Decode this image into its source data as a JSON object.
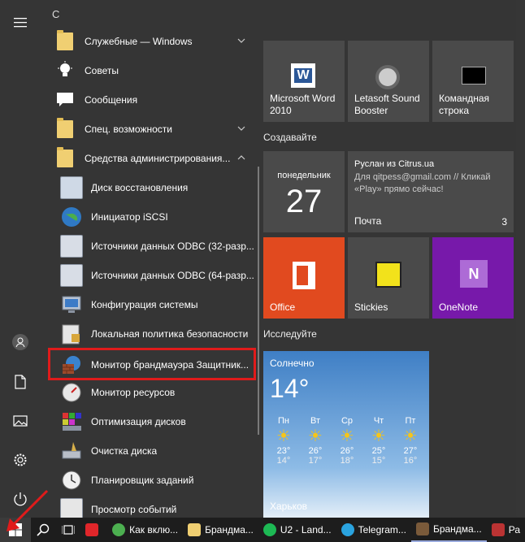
{
  "rail": {
    "icons": [
      "hamburger-icon",
      "user-icon",
      "document-icon",
      "pictures-icon",
      "settings-icon",
      "power-icon"
    ]
  },
  "applist": {
    "letter": "С",
    "items": [
      {
        "label": "Служебные — Windows",
        "icon": "folder-icon",
        "chevron": "down"
      },
      {
        "label": "Советы",
        "icon": "lightbulb-icon"
      },
      {
        "label": "Сообщения",
        "icon": "chat-icon"
      },
      {
        "label": "Спец. возможности",
        "icon": "folder-icon",
        "chevron": "down"
      },
      {
        "label": "Средства администрирования...",
        "icon": "folder-icon",
        "chevron": "up"
      },
      {
        "label": "Диск восстановления",
        "icon": "recovery-drive-icon"
      },
      {
        "label": "Инициатор iSCSI",
        "icon": "iscsi-globe-icon"
      },
      {
        "label": "Источники данных ODBC (32-разр...",
        "icon": "odbc-icon"
      },
      {
        "label": "Источники данных ODBC (64-разр...",
        "icon": "odbc-icon"
      },
      {
        "label": "Конфигурация системы",
        "icon": "system-config-icon"
      },
      {
        "label": "Локальная политика безопасности",
        "icon": "security-policy-icon"
      },
      {
        "label": "Монитор брандмауэра Защитник...",
        "icon": "firewall-icon"
      },
      {
        "label": "Монитор ресурсов",
        "icon": "resource-monitor-icon"
      },
      {
        "label": "Оптимизация дисков",
        "icon": "defrag-icon"
      },
      {
        "label": "Очистка диска",
        "icon": "disk-cleanup-icon"
      },
      {
        "label": "Планировщик заданий",
        "icon": "task-scheduler-icon"
      },
      {
        "label": "Просмотр событий",
        "icon": "event-viewer-icon"
      }
    ]
  },
  "tiles": {
    "top": [
      {
        "label": "Microsoft Word 2010",
        "icon": "word-icon"
      },
      {
        "label": "Letasoft Sound Booster",
        "icon": "speaker-icon"
      },
      {
        "label": "Командная строка",
        "icon": "cmd-icon"
      }
    ],
    "group1": "Создавайте",
    "calendar": {
      "day": "понедельник",
      "date": "27"
    },
    "mail": {
      "sender": "Руслан из Citrus.ua",
      "body": "Для qitpess@gmail.com // Кликай «Play» прямо сейчас!",
      "app": "Почта",
      "count": "3"
    },
    "row3": [
      {
        "label": "Office",
        "color": "#e14a1f"
      },
      {
        "label": "Stickies",
        "color": "#4a4a4a"
      },
      {
        "label": "OneNote",
        "color": "#7719aa"
      }
    ],
    "group2": "Исследуйте",
    "weather": {
      "condition": "Солнечно",
      "temp": "14°",
      "city": "Харьков",
      "days": [
        {
          "name": "Пн",
          "high": "23°",
          "low": "14°"
        },
        {
          "name": "Вт",
          "high": "26°",
          "low": "17°"
        },
        {
          "name": "Ср",
          "high": "26°",
          "low": "18°"
        },
        {
          "name": "Чт",
          "high": "25°",
          "low": "15°"
        },
        {
          "name": "Пт",
          "high": "27°",
          "low": "16°"
        }
      ]
    }
  },
  "taskbar": {
    "apps": [
      {
        "label": "",
        "icon": "vivaldi-icon",
        "color": "#e0262a"
      },
      {
        "label": "Как вклю...",
        "icon": "chrome-icon",
        "color": "#4caf50"
      },
      {
        "label": "Брандма...",
        "icon": "folder-icon",
        "color": "#f0cf72"
      },
      {
        "label": "U2 - Land...",
        "icon": "spotify-icon",
        "color": "#1db954"
      },
      {
        "label": "Telegram...",
        "icon": "telegram-icon",
        "color": "#2aa3df"
      },
      {
        "label": "Брандма...",
        "icon": "firewall-icon",
        "color": "#7a5a3a"
      },
      {
        "label": "Ра",
        "icon": "app-icon",
        "color": "#b33"
      }
    ]
  }
}
